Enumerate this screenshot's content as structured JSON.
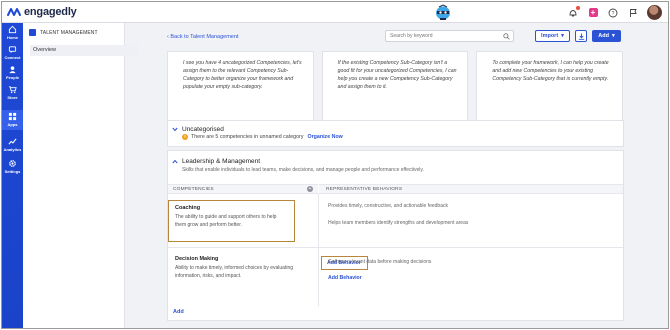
{
  "app": {
    "logo_text": "engagedly"
  },
  "leftnav": {
    "items": [
      {
        "label": "Home",
        "icon": "home-icon"
      },
      {
        "label": "Connect",
        "icon": "connect-icon"
      },
      {
        "label": "People",
        "icon": "people-icon"
      },
      {
        "label": "Store",
        "icon": "cart-icon"
      },
      {
        "label": "Apps",
        "icon": "apps-icon"
      },
      {
        "label": "Analytics",
        "icon": "analytics-icon"
      },
      {
        "label": "Settings",
        "icon": "gear-icon"
      }
    ]
  },
  "subnav": {
    "title": "TALENT MANAGEMENT",
    "items": [
      {
        "label": "Overview"
      }
    ]
  },
  "header": {
    "back_link": "Back to Talent Management",
    "search_placeholder": "Search by keyword",
    "import_label": "Import",
    "add_label": "Add"
  },
  "cards": [
    {
      "text": "I see you have 4 uncategorized Competencies, let's assign them to the relevant Competency Sub-Category to better organize your framework and populate your empty sub-category."
    },
    {
      "text": "If the existing Competency Sub-Category isn't a good fit for your uncategorized Competencies, I can help you create a new Competency Sub-Category and assign them to it."
    },
    {
      "text": "To complete your framework, I can help you create and add new Competencies to your existing Competency Sub-Category that is currently empty."
    }
  ],
  "uncategorised": {
    "title": "Uncategorised",
    "message": "There are  5 competencies in unnamed category",
    "action": "Organize Now"
  },
  "leadership": {
    "title": "Leadership & Management",
    "description": "Skills that enable individuals to lead teams, make decisions, and manage people and performance effectively.",
    "col_competencies": "COMPETENCIES",
    "col_behaviors": "REPRESENTATIVE BEHAVIORS",
    "competencies": [
      {
        "name": "Coaching",
        "description": "The ability to guide and support others to help them grow and perform better.",
        "behaviors": [
          "Provides timely, constructive, and actionable feedback",
          "Helps team members identify strengths and development areas"
        ],
        "add_behavior": "Add Behavior"
      },
      {
        "name": "Decision Making",
        "description": "Ability to make timely, informed choices by evaluating information, risks, and impact.",
        "behaviors": [
          "Gathers relevant data before making decisions"
        ],
        "add_behavior": "Add Behavior"
      }
    ],
    "add_label": "Add"
  },
  "colors": {
    "brand_blue": "#1f49d6",
    "link_blue": "#2b53d6",
    "highlight": "#b8863b",
    "warning": "#f0a21d"
  }
}
